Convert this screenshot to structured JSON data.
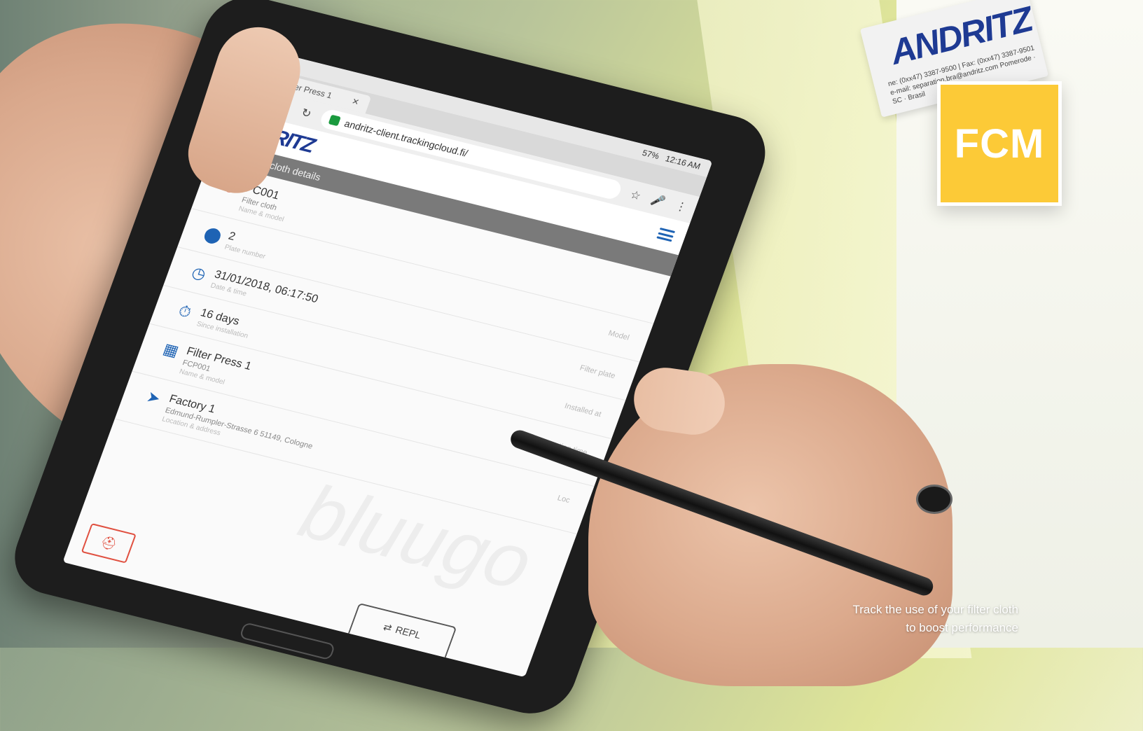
{
  "tablet": {
    "tab_title": "1234 - Filter Press 1",
    "url": "andritz-client.trackingcloud.fi/",
    "status": {
      "battery": "57%",
      "time": "12:16 AM"
    },
    "app_logo": "ANDRITZ",
    "section_title": "Filter cloth details",
    "rows": [
      {
        "main": "FC001",
        "sub": "Filter cloth",
        "sub2": "Name & model",
        "right": ""
      },
      {
        "main": "2",
        "sub": "",
        "sub2": "Plate number",
        "right": "Model"
      },
      {
        "main": "31/01/2018, 06:17:50",
        "sub": "",
        "sub2": "Date & time",
        "right": "Filter plate"
      },
      {
        "main": "16 days",
        "sub": "",
        "sub2": "Since installation",
        "right": "Installed at"
      },
      {
        "main": "Filter Press 1",
        "sub": "FCP001",
        "sub2": "Name & model",
        "right": "Operating time"
      },
      {
        "main": "Factory 1",
        "sub": "Edmund-Rumpler-Strasse 6 51149, Cologne",
        "sub2": "Location & address",
        "right": "Loc"
      }
    ],
    "replace_label": "REPL",
    "watermark": "bluugo"
  },
  "sticker": {
    "logo": "ANDRITZ",
    "text": "ne: (0xx47) 3387-9500 | Fax: (0xx47) 3387-9501  e-mail: separation.bra@andritz.com  Pomerode · SC · Brasil"
  },
  "badge": {
    "label": "FCM",
    "color": "#fcca37"
  },
  "tagline": {
    "line1": "Track the use of your filter cloth",
    "line2": "to boost performance"
  },
  "colors": {
    "brand_blue": "#1e3a93",
    "accent_red": "#e05040"
  }
}
